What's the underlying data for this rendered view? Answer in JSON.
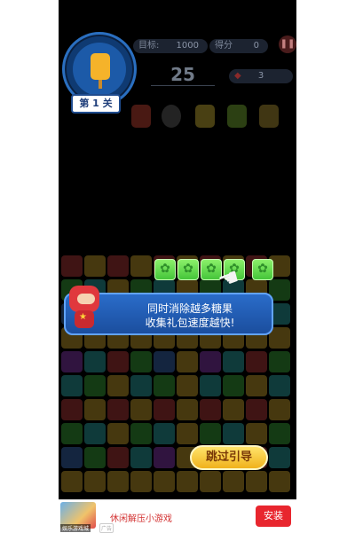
{
  "hud": {
    "level_label": "第 1 关",
    "target_label": "目标:",
    "target_value": "1000",
    "score_label": "得分",
    "score_value": "0",
    "moves": "25",
    "gems_value": "3",
    "pause_icon": "pause-icon"
  },
  "tutorial": {
    "message": "同时消除越多糖果\n收集礼包速度越快!",
    "skip_label": "跳过引导",
    "highlighted_candies": 5
  },
  "ad": {
    "brand": "娱乐游戏城",
    "tag": "广告",
    "title": "休闲解压小游戏",
    "install_label": "安装"
  },
  "colors": {
    "tooltip_blue": "#2a6cc9",
    "candy_green": "#6de052",
    "skip_yellow": "#f5c73a",
    "install_red": "#e8262e"
  }
}
